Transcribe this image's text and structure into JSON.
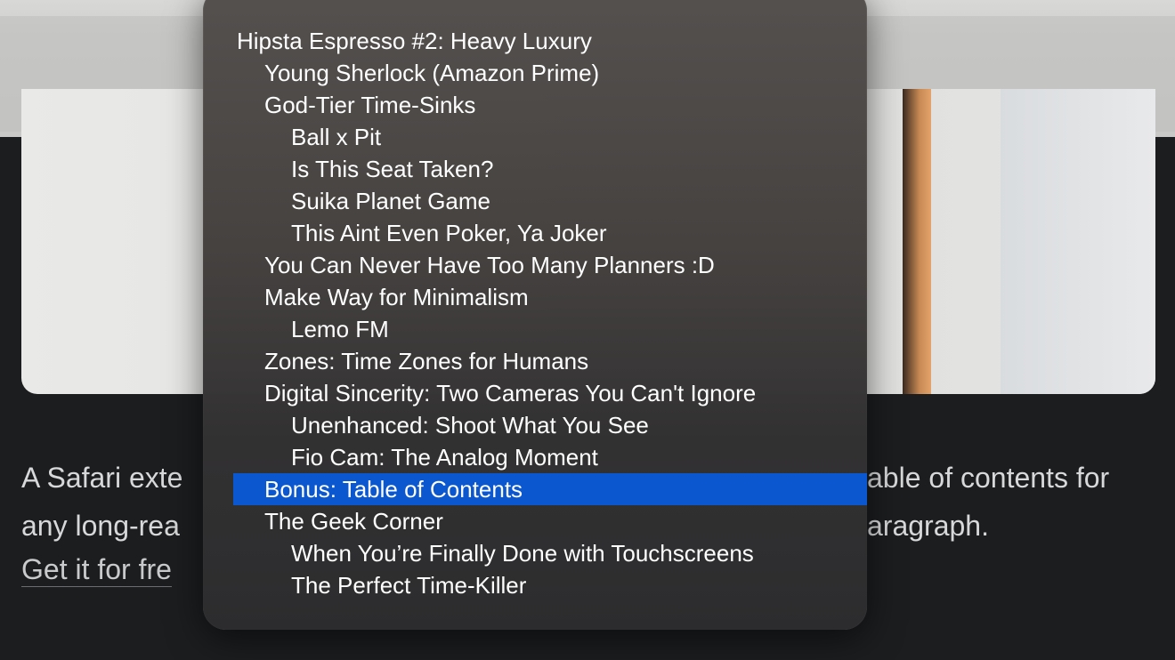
{
  "article": {
    "line1_left": "A Safari exte",
    "line1_right": "able of contents for",
    "line2_left": "any long-rea",
    "line2_right": "aragraph.",
    "link_text": "Get it for fre"
  },
  "menu": {
    "items": [
      {
        "label": "Hipsta Espresso #2: Heavy Luxury",
        "level": 0,
        "selected": false
      },
      {
        "label": "Young Sherlock (Amazon Prime)",
        "level": 1,
        "selected": false
      },
      {
        "label": "God-Tier Time-Sinks",
        "level": 1,
        "selected": false
      },
      {
        "label": "Ball x Pit",
        "level": 2,
        "selected": false
      },
      {
        "label": "Is This Seat Taken?",
        "level": 2,
        "selected": false
      },
      {
        "label": "Suika Planet Game",
        "level": 2,
        "selected": false
      },
      {
        "label": "This Aint Even Poker, Ya Joker",
        "level": 2,
        "selected": false
      },
      {
        "label": "You Can Never Have Too Many Planners :D",
        "level": 1,
        "selected": false
      },
      {
        "label": "Make Way for Minimalism",
        "level": 1,
        "selected": false
      },
      {
        "label": "Lemo FM",
        "level": 2,
        "selected": false
      },
      {
        "label": "Zones: Time Zones for Humans",
        "level": 1,
        "selected": false
      },
      {
        "label": "Digital Sincerity: Two Cameras You Can't Ignore",
        "level": 1,
        "selected": false
      },
      {
        "label": "Unenhanced: Shoot What You See",
        "level": 2,
        "selected": false
      },
      {
        "label": "Fio Cam: The Analog Moment",
        "level": 2,
        "selected": false
      },
      {
        "label": "Bonus: Table of Contents",
        "level": 1,
        "selected": true
      },
      {
        "label": "The Geek Corner",
        "level": 1,
        "selected": false
      },
      {
        "label": "When You’re Finally Done with Touchscreens",
        "level": 2,
        "selected": false
      },
      {
        "label": "The Perfect Time-Killer",
        "level": 2,
        "selected": false
      }
    ]
  },
  "colors": {
    "selection": "#0a57d0",
    "menu_text": "#ffffff",
    "page_background": "#1b1d1f"
  }
}
